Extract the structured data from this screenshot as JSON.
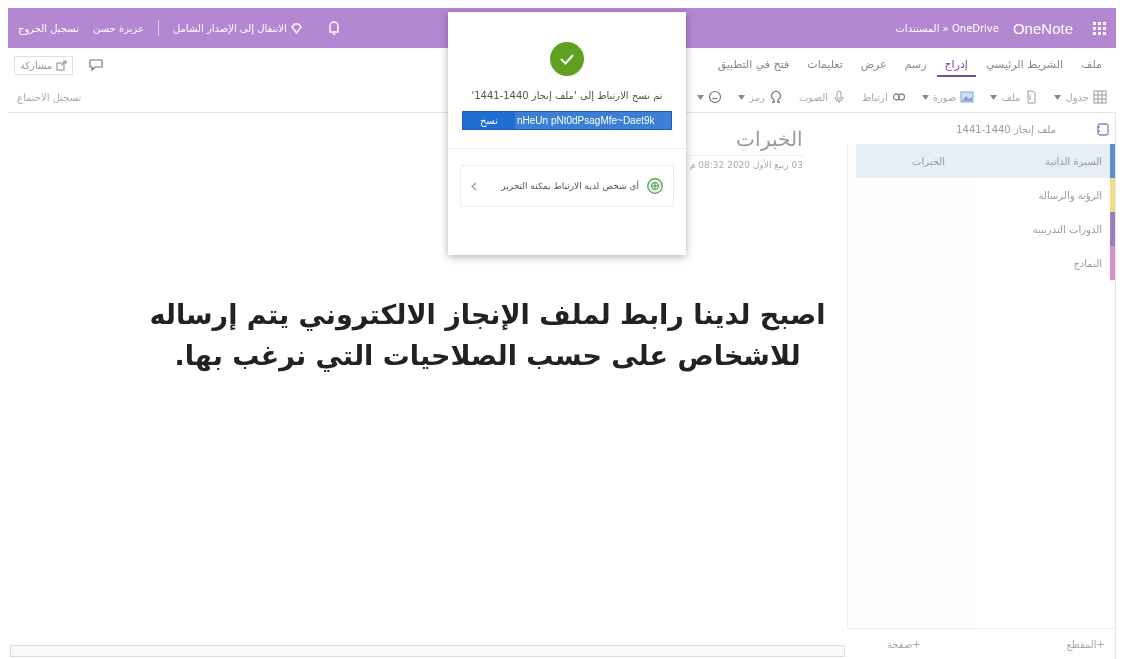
{
  "top_bar": {
    "app_name": "OneNote",
    "breadcrumb": "OneDrive « المستندات",
    "upgrade_link": "الانتقال إلى الإصدار الشامل",
    "user_name": "عزيزة حسن",
    "sign_out": "تسجيل الخروج"
  },
  "ribbon": {
    "tabs": [
      {
        "label": "ملف",
        "selected": false
      },
      {
        "label": "الشريط الرئيسي",
        "selected": false
      },
      {
        "label": "إدراج",
        "selected": true
      },
      {
        "label": "رسم",
        "selected": false
      },
      {
        "label": "عرض",
        "selected": false
      },
      {
        "label": "تعليمات",
        "selected": false
      },
      {
        "label": "فتح في التطبيق",
        "selected": false
      }
    ],
    "share_button": "مشاركة",
    "tools": [
      {
        "kind": "table",
        "label": "جدول",
        "dropdown": true
      },
      {
        "kind": "file",
        "label": "ملف",
        "dropdown": true
      },
      {
        "kind": "picture",
        "label": "صورة",
        "dropdown": true
      },
      {
        "kind": "link",
        "label": "ارتباط",
        "dropdown": false
      },
      {
        "kind": "audio",
        "label": "الصوت",
        "dropdown": false
      },
      {
        "kind": "symbol",
        "label": "رمز",
        "dropdown": true
      },
      {
        "kind": "emoji",
        "dropdown": true
      }
    ],
    "meeting_tool": "تسجيل الاجتماع"
  },
  "notebook": {
    "title": "ملف إنجاز 1440-1441",
    "sections": [
      {
        "label": "السيرة الذاتية",
        "color": "#5b8fd0",
        "selected": true
      },
      {
        "label": "الرؤية والرسالة",
        "color": "#f2dc86",
        "selected": false
      },
      {
        "label": "الدورات التدريبية",
        "color": "#9a7fc0",
        "selected": false
      },
      {
        "label": "النماذج",
        "color": "#d98fc8",
        "selected": false
      }
    ],
    "pages": [
      {
        "label": "الخبرات",
        "selected": true
      }
    ],
    "add_section": "+المقطع",
    "add_page": "+صفحة"
  },
  "page": {
    "title": "الخبرات",
    "date": "03 ربيع الأول 2020 08:32 م",
    "overlay_text": "اصبح لدينا رابط لملف الإنجاز الالكتروني يتم إرساله للاشخاص على حسب الصلاحيات التي نرغب بها."
  },
  "share_dialog": {
    "message": "تم نسخ الارتباط إلى 'ملف إنجاز 1440-1441'",
    "link": "nHeUn pNt0dPsagMfe~Daet9k",
    "copy_button": "نسخ",
    "permission": "أي شخص لديه الارتباط يمكنه التحرير"
  }
}
